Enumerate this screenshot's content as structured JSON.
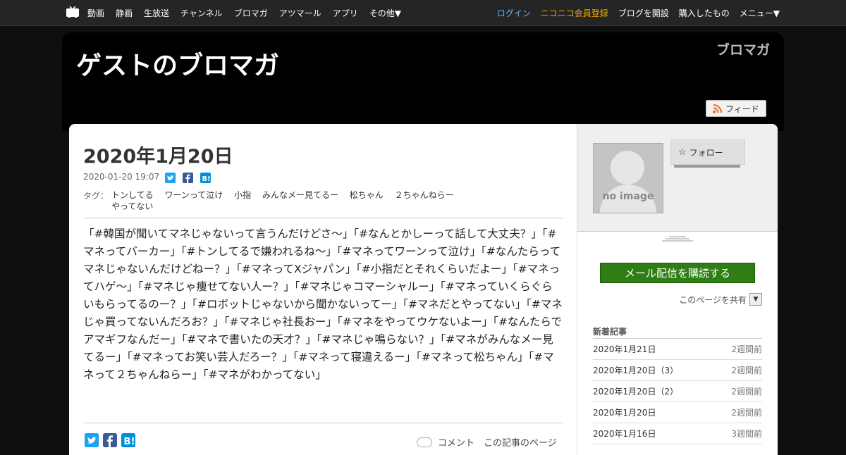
{
  "topnav": {
    "left_items": [
      "動画",
      "静画",
      "生放送",
      "チャンネル",
      "ブロマガ",
      "アツマール",
      "アプリ",
      "その他▼"
    ],
    "login": "ログイン",
    "register": "ニコニコ会員登録",
    "open_blog": "ブログを開設",
    "purchased": "購入したもの",
    "menu": "メニュー▼"
  },
  "header": {
    "blog_title": "ゲストのブロマガ",
    "logo_text": "ブロマガ",
    "feed_label": "フィード"
  },
  "post": {
    "title": "2020年1月20日",
    "datetime": "2020-01-20 19:07",
    "tags_label": "タグ：",
    "tags": [
      "トンしてる",
      "ワーンって泣け",
      "小指",
      "みんなメー見てるー",
      "松ちゃん",
      "２ちゃんねらー",
      "やってない"
    ],
    "body": "「#韓国が聞いてマネじゃないって言うんだけどさ〜」「#なんとかしーって話して大丈夫？」「#マネってバーカー」「#トンしてるで嫌われるね〜」「#マネってワーンって泣け」「#なんたらってマネじゃないんだけどねー？」「#マネってXジャパン」「#小指だとそれくらいだよー」「#マネってハゲ〜」「#マネじゃ痩せてない人ー？」「#マネじゃコマーシャルー」「#マネっていくらぐらいもらってるのー？」「#ロボットじゃないから聞かないってー」「#マネだとやってない」「#マネじゃ買ってないんだろお？」「#マネじゃ社長おー」「#マネをやってウケないよー」「#なんたらでアマギフなんだー」「#マネで書いたの天才？」「#マネじゃ鳴らない？」「#マネがみんなメー見てるー」「#マネってお笑い芸人だろー？」「#マネって寝違えるー」「#マネって松ちゃん」「#マネって２ちゃんねらー」「#マネがわかってない」",
    "comment_link": "コメント　この記事のページ"
  },
  "sidebar": {
    "no_image": "no image",
    "follow_label": "フォロー",
    "subscribe_label": "メール配信を購読する",
    "share_page": "このページを共有",
    "recent_title": "新着記事",
    "recent": [
      {
        "title": "2020年1月21日",
        "age": "2週間前"
      },
      {
        "title": "2020年1月20日（3）",
        "age": "2週間前"
      },
      {
        "title": "2020年1月20日（2）",
        "age": "2週間前"
      },
      {
        "title": "2020年1月20日",
        "age": "2週間前"
      },
      {
        "title": "2020年1月16日",
        "age": "3週間前"
      }
    ]
  },
  "colors": {
    "link_blue": "#5bb8ff",
    "register_gold": "#f0a500",
    "subscribe_green": "#2e7d15",
    "twitter_blue": "#1da1f2",
    "facebook_blue": "#3b5998",
    "hatena_blue": "#008fde",
    "rss_orange": "#f26522"
  },
  "icons": {
    "site": "tv-icon",
    "feed": "rss-icon",
    "share": [
      "twitter-icon",
      "facebook-icon",
      "hatena-bookmark-icon"
    ],
    "follow": "star-icon",
    "comment": "comment-icon",
    "dropdown": "dropdown-arrow-icon"
  }
}
